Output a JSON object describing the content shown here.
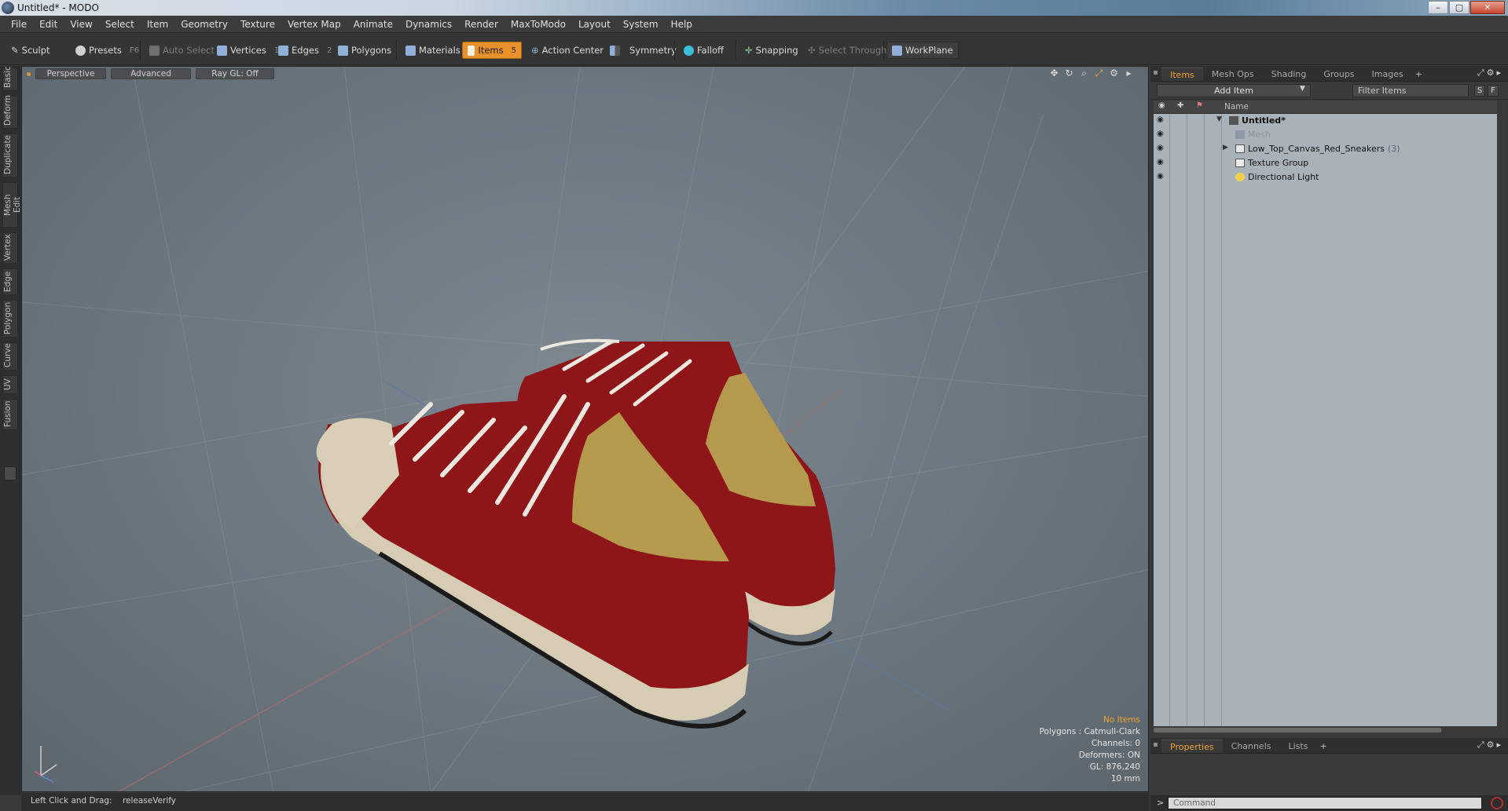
{
  "window": {
    "title": "Untitled* - MODO",
    "controls": [
      "–",
      "▢",
      "✕"
    ]
  },
  "menu": [
    "File",
    "Edit",
    "View",
    "Select",
    "Item",
    "Geometry",
    "Texture",
    "Vertex Map",
    "Animate",
    "Dynamics",
    "Render",
    "MaxToModo",
    "Layout",
    "System",
    "Help"
  ],
  "toolbar": {
    "sculpt": "Sculpt",
    "presets": "Presets",
    "presets_key": "F6",
    "auto_select": "Auto Select",
    "vertices": "Vertices",
    "vertices_key": "1",
    "edges": "Edges",
    "edges_key": "2",
    "polygons": "Polygons",
    "materials": "Materials",
    "items": "Items",
    "items_key": "5",
    "action_center": "Action Center",
    "symmetry": "Symmetry",
    "falloff": "Falloff",
    "snapping": "Snapping",
    "select_through": "Select Through",
    "workplane": "WorkPlane"
  },
  "left_tabs": [
    "Basic",
    "Deform",
    "Duplicate",
    "Mesh Edit",
    "Vertex",
    "Edge",
    "Polygon",
    "Curve",
    "UV",
    "Fusion"
  ],
  "viewport": {
    "view_mode": "Perspective",
    "shading": "Advanced",
    "raygl": "Ray GL: Off",
    "info": {
      "selection": "No Items",
      "polygons": "Polygons : Catmull-Clark",
      "channels": "Channels: 0",
      "deformers": "Deformers: ON",
      "gl": "GL: 876,240",
      "scale": "10 mm"
    },
    "colors": {
      "shoe_red": "#8e1518",
      "sole": "#d6ccb4",
      "lining": "#b59a4d",
      "laces": "#ece8df"
    }
  },
  "status": {
    "hint_key": "Left Click and Drag:",
    "hint_value": "releaseVerify"
  },
  "items_panel": {
    "tabs": [
      "Items",
      "Mesh Ops",
      "Shading",
      "Groups",
      "Images",
      "+"
    ],
    "add_item": "Add Item",
    "filter_placeholder": "Filter Items",
    "btn_s": "S",
    "btn_f": "F",
    "col_name": "Name",
    "rows": [
      {
        "label": "Untitled*",
        "count": ""
      },
      {
        "label": "Mesh",
        "count": ""
      },
      {
        "label": "Low_Top_Canvas_Red_Sneakers",
        "count": "(3)"
      },
      {
        "label": "Texture Group",
        "count": ""
      },
      {
        "label": "Directional Light",
        "count": ""
      }
    ]
  },
  "props_panel": {
    "tabs": [
      "Properties",
      "Channels",
      "Lists",
      "+"
    ]
  },
  "command": {
    "prompt": ">",
    "placeholder": "Command"
  },
  "accent": "#e8902a"
}
